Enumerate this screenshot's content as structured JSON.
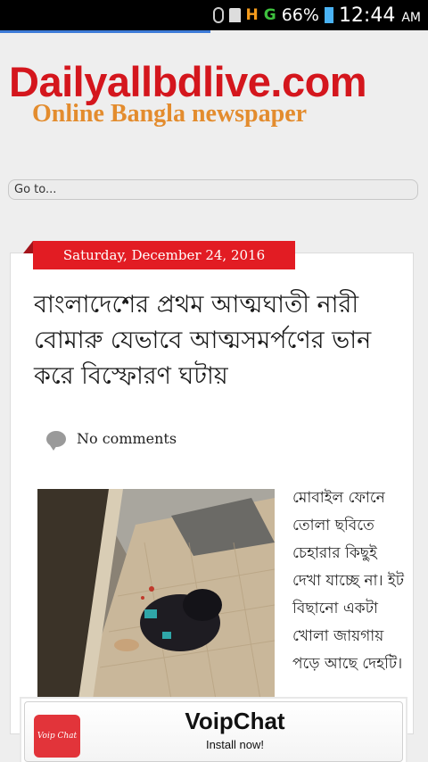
{
  "status_bar": {
    "battery_percent": "66%",
    "time": "12:44",
    "ampm": "AM",
    "network_1": "H",
    "network_2": "G",
    "icons": [
      "bluetooth-icon",
      "sd-card-icon",
      "signal-icon",
      "battery-icon"
    ]
  },
  "header": {
    "site_title": "Dailyallbdlive.com",
    "subtitle": "Online Bangla newspaper"
  },
  "nav": {
    "goto_label": "Go to..."
  },
  "post": {
    "date": "Saturday, December 24, 2016",
    "title": "বাংলাদেশের প্রথম আত্মঘাতী নারী বোমারু যেভাবে আত্মসমর্পণের ভান করে বিস্ফোরণ ঘটায়",
    "comments": "No comments",
    "body": "মোবাইল ফোনে তোলা ছবিতে চেহারার কিছুই দেখা যাচ্ছে না। ইট বিছানো একটা খোলা জায়গায় পড়ে আছে দেহটি।"
  },
  "ad": {
    "logo_text": "Voip Chat",
    "title": "VoipChat",
    "cta": "Install now!"
  },
  "colors": {
    "brand_red": "#d4161d",
    "subtitle_orange": "#e38c2e",
    "ribbon_red": "#e21c23"
  }
}
